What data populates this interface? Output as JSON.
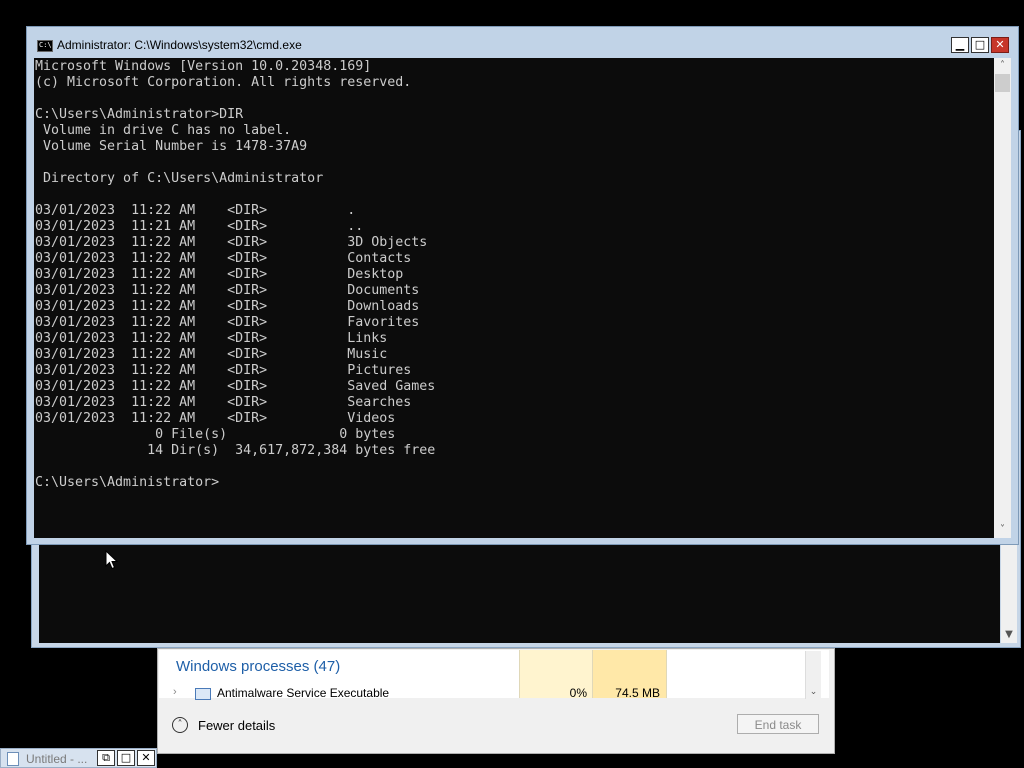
{
  "cmd_window": {
    "title": "Administrator: C:\\Windows\\system32\\cmd.exe",
    "icon_label": "C:\\",
    "controls": {
      "minimize": "▁",
      "maximize": "□",
      "close": "✕"
    },
    "console_lines": [
      "Microsoft Windows [Version 10.0.20348.169]",
      "(c) Microsoft Corporation. All rights reserved.",
      "",
      "C:\\Users\\Administrator>DIR",
      " Volume in drive C has no label.",
      " Volume Serial Number is 1478-37A9",
      "",
      " Directory of C:\\Users\\Administrator",
      "",
      "03/01/2023  11:22 AM    <DIR>          .",
      "03/01/2023  11:21 AM    <DIR>          ..",
      "03/01/2023  11:22 AM    <DIR>          3D Objects",
      "03/01/2023  11:22 AM    <DIR>          Contacts",
      "03/01/2023  11:22 AM    <DIR>          Desktop",
      "03/01/2023  11:22 AM    <DIR>          Documents",
      "03/01/2023  11:22 AM    <DIR>          Downloads",
      "03/01/2023  11:22 AM    <DIR>          Favorites",
      "03/01/2023  11:22 AM    <DIR>          Links",
      "03/01/2023  11:22 AM    <DIR>          Music",
      "03/01/2023  11:22 AM    <DIR>          Pictures",
      "03/01/2023  11:22 AM    <DIR>          Saved Games",
      "03/01/2023  11:22 AM    <DIR>          Searches",
      "03/01/2023  11:22 AM    <DIR>          Videos",
      "               0 File(s)              0 bytes",
      "              14 Dir(s)  34,617,872,384 bytes free",
      "",
      "C:\\Users\\Administrator>"
    ]
  },
  "task_manager": {
    "section_title": "Windows processes (47)",
    "visible_row": {
      "name": "Antimalware Service Executable",
      "cpu": "0%",
      "memory": "74.5 MB"
    },
    "fewer_details_label": "Fewer details",
    "end_task_label": "End task"
  },
  "minimized_window": {
    "title": "Untitled - ...",
    "controls": {
      "restore": "⧉",
      "maximize": "□",
      "close": "✕"
    }
  },
  "colors": {
    "console_bg": "#0c0c0c",
    "console_text": "#cccccc",
    "window_frame": "#c1d3e7",
    "close_button": "#c7362a",
    "section_title": "#1e5fa8"
  }
}
